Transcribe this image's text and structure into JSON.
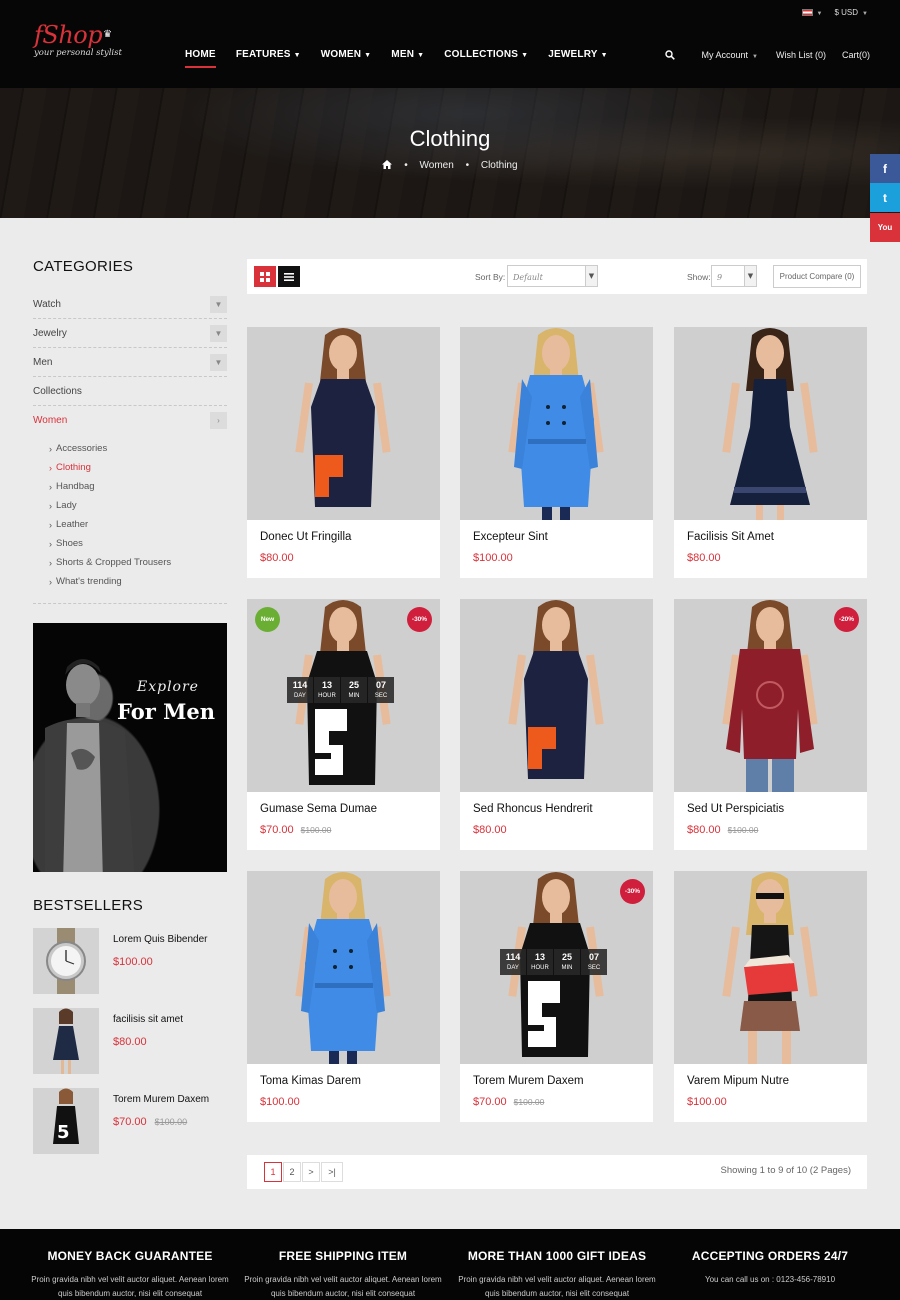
{
  "header": {
    "logo_text": "fShop",
    "logo_tagline": "your personal stylist",
    "currency": "$ USD",
    "nav": [
      "HOME",
      "FEATURES",
      "WOMEN",
      "MEN",
      "COLLECTIONS",
      "JEWELRY"
    ],
    "my_account": "My Account",
    "wish_list": "Wish List (0)",
    "cart": "Cart(0)"
  },
  "banner": {
    "title": "Clothing",
    "crumbs": [
      "Women",
      "Clothing"
    ]
  },
  "social": {
    "facebook": "f",
    "twitter": "t",
    "youtube": "You"
  },
  "sidebar": {
    "categories_title": "CATEGORIES",
    "categories": [
      {
        "label": "Watch",
        "expandable": true
      },
      {
        "label": "Jewelry",
        "expandable": true
      },
      {
        "label": "Men",
        "expandable": true
      },
      {
        "label": "Collections",
        "expandable": false
      },
      {
        "label": "Women",
        "expandable": true
      }
    ],
    "women_sub": [
      "Accessories",
      "Clothing",
      "Handbag",
      "Lady",
      "Leather",
      "Shoes",
      "Shorts & Cropped Trousers",
      "What's trending"
    ],
    "promo_line1": "Explore",
    "promo_line2": "For Men",
    "bestsellers_title": "BESTSELLERS",
    "bestsellers": [
      {
        "name": "Lorem Quis Bibender",
        "price": "$100.00",
        "old": ""
      },
      {
        "name": "facilisis sit amet",
        "price": "$80.00",
        "old": ""
      },
      {
        "name": "Torem Murem Daxem",
        "price": "$70.00",
        "old": "$100.00"
      }
    ]
  },
  "toolbar": {
    "sort_label": "Sort By:",
    "sort_value": "Default",
    "show_label": "Show:",
    "show_value": "9",
    "compare": "Product Compare (0)"
  },
  "products": [
    {
      "name": "Donec Ut Fringilla",
      "price": "$80.00",
      "old": "",
      "badge_new": "",
      "badge_sale": "",
      "countdown": false,
      "dress": "navy5",
      "hair": "brown"
    },
    {
      "name": "Excepteur Sint",
      "price": "$100.00",
      "old": "",
      "badge_new": "",
      "badge_sale": "",
      "countdown": false,
      "dress": "bluecoat",
      "hair": "blonde"
    },
    {
      "name": "Facilisis Sit Amet",
      "price": "$80.00",
      "old": "",
      "badge_new": "",
      "badge_sale": "",
      "countdown": false,
      "dress": "navydress",
      "hair": "dark"
    },
    {
      "name": "Gumase Sema Dumae",
      "price": "$70.00",
      "old": "$100.00",
      "badge_new": "New",
      "badge_sale": "-30%",
      "countdown": true,
      "dress": "black5",
      "hair": "brown"
    },
    {
      "name": "Sed Rhoncus Hendrerit",
      "price": "$80.00",
      "old": "",
      "badge_new": "",
      "badge_sale": "",
      "countdown": false,
      "dress": "navy5",
      "hair": "brown"
    },
    {
      "name": "Sed Ut Perspiciatis",
      "price": "$80.00",
      "old": "$100.00",
      "badge_new": "",
      "badge_sale": "-20%",
      "countdown": false,
      "dress": "redsweater",
      "hair": "brown"
    },
    {
      "name": "Toma Kimas Darem",
      "price": "$100.00",
      "old": "",
      "badge_new": "",
      "badge_sale": "",
      "countdown": false,
      "dress": "bluecoat",
      "hair": "blonde"
    },
    {
      "name": "Torem Murem Daxem",
      "price": "$70.00",
      "old": "$100.00",
      "badge_new": "",
      "badge_sale": "-30%",
      "countdown": true,
      "dress": "black5",
      "hair": "brown"
    },
    {
      "name": "Varem Mipum Nutre",
      "price": "$100.00",
      "old": "",
      "badge_new": "",
      "badge_sale": "",
      "countdown": false,
      "dress": "tanktop",
      "hair": "blonde"
    }
  ],
  "countdown": [
    {
      "value": "114",
      "unit": "DAY"
    },
    {
      "value": "13",
      "unit": "HOUR"
    },
    {
      "value": "25",
      "unit": "MIN"
    },
    {
      "value": "07",
      "unit": "SEC"
    }
  ],
  "pagination": {
    "pages": [
      "1",
      "2",
      ">",
      ">|"
    ],
    "showing": "Showing 1 to 9 of 10 (2 Pages)"
  },
  "footer": [
    {
      "title": "MONEY BACK GUARANTEE",
      "text": "Proin gravida nibh vel velit auctor aliquet. Aenean lorem quis bibendum auctor, nisi elit consequat"
    },
    {
      "title": "FREE SHIPPING ITEM",
      "text": "Proin gravida nibh vel velit auctor aliquet. Aenean lorem quis bibendum auctor, nisi elit consequat"
    },
    {
      "title": "MORE THAN 1000 GIFT IDEAS",
      "text": "Proin gravida nibh vel velit auctor aliquet. Aenean lorem quis bibendum auctor, nisi elit consequat"
    },
    {
      "title": "ACCEPTING ORDERS 24/7",
      "text": "You can call us on : 0123-456-78910"
    }
  ],
  "colors": {
    "accent": "#d9323a",
    "new_badge": "#6bae34",
    "sale_badge": "#d01f3c",
    "header_bg": "#060606"
  }
}
